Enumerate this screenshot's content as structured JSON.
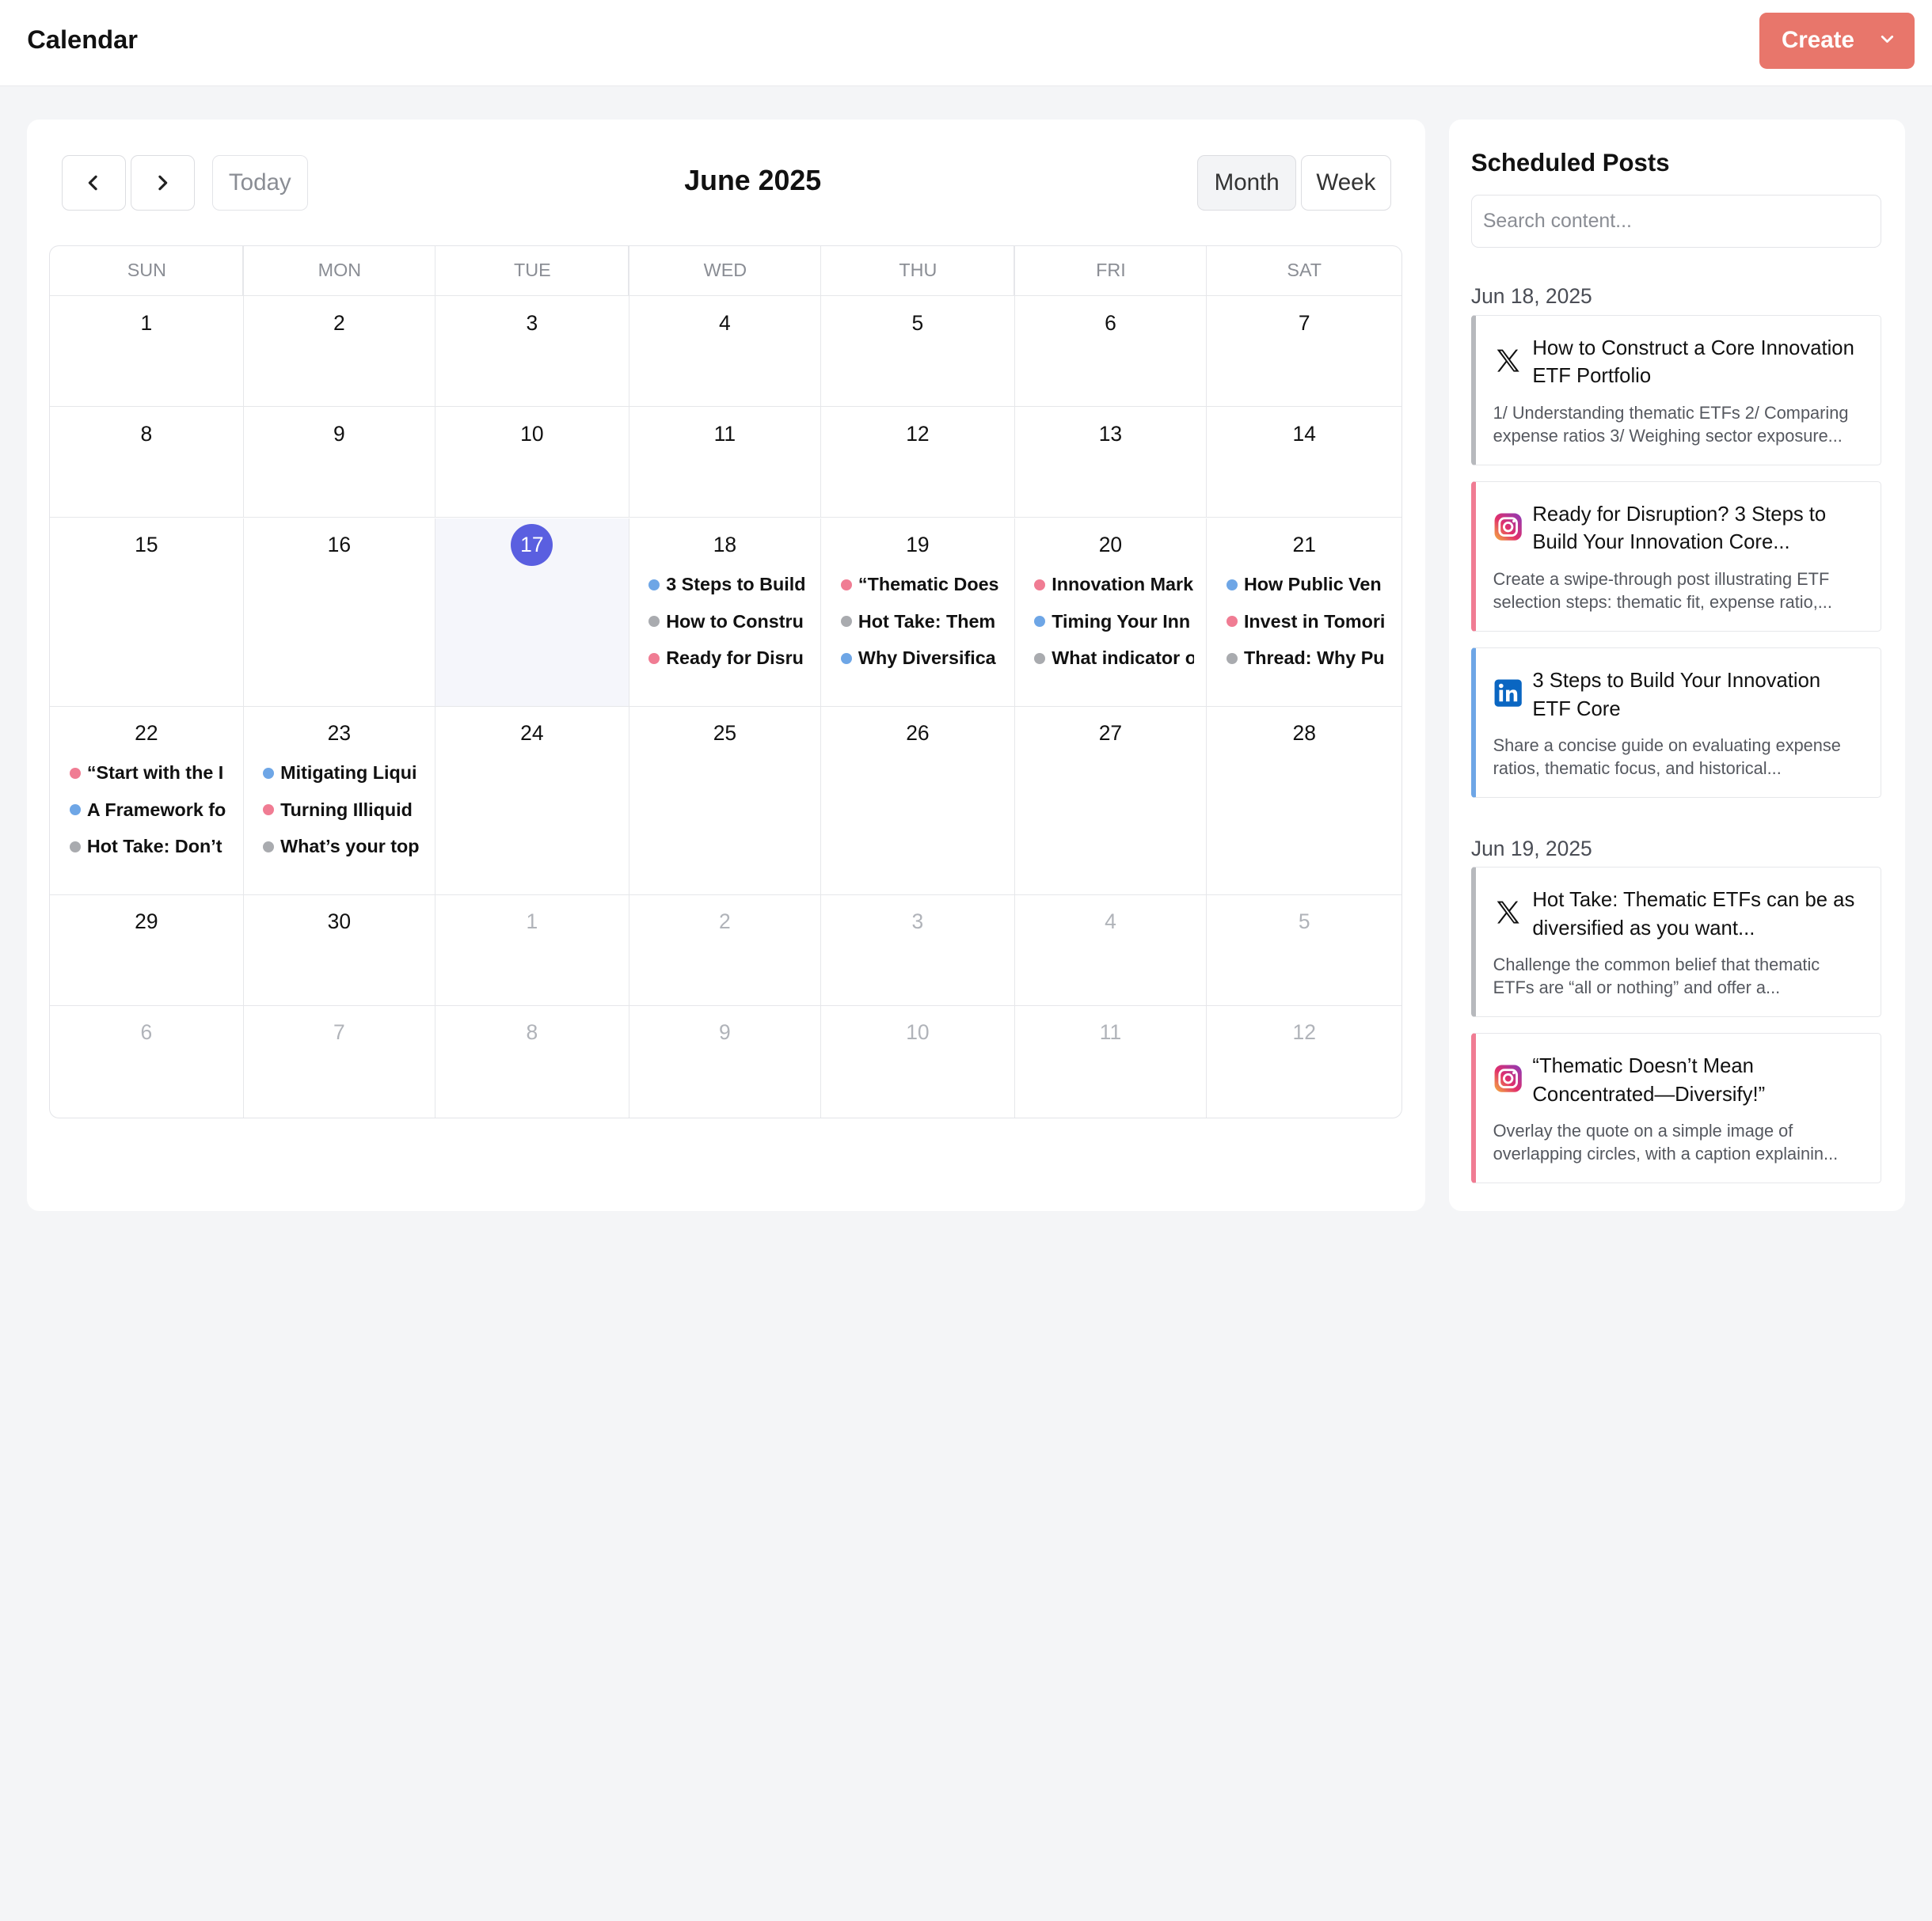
{
  "header": {
    "title": "Calendar",
    "create_label": "Create"
  },
  "calendar": {
    "today_label": "Today",
    "month_title": "June 2025",
    "views": [
      "Month",
      "Week"
    ],
    "active_view": "Month",
    "weekdays": [
      "SUN",
      "MON",
      "TUE",
      "WED",
      "THU",
      "FRI",
      "SAT"
    ],
    "today": 17,
    "weeks": [
      [
        {
          "d": "1"
        },
        {
          "d": "2"
        },
        {
          "d": "3"
        },
        {
          "d": "4"
        },
        {
          "d": "5"
        },
        {
          "d": "6"
        },
        {
          "d": "7"
        }
      ],
      [
        {
          "d": "8"
        },
        {
          "d": "9"
        },
        {
          "d": "10"
        },
        {
          "d": "11"
        },
        {
          "d": "12"
        },
        {
          "d": "13"
        },
        {
          "d": "14"
        }
      ],
      [
        {
          "d": "15"
        },
        {
          "d": "16"
        },
        {
          "d": "17",
          "today": true
        },
        {
          "d": "18",
          "events": [
            {
              "color": "blue",
              "text": "3 Steps to Build"
            },
            {
              "color": "gray",
              "text": "How to Constru"
            },
            {
              "color": "pink",
              "text": "Ready for Disru"
            }
          ]
        },
        {
          "d": "19",
          "events": [
            {
              "color": "pink",
              "text": "“Thematic Does"
            },
            {
              "color": "gray",
              "text": "Hot Take: Them"
            },
            {
              "color": "blue",
              "text": "Why Diversifica"
            }
          ]
        },
        {
          "d": "20",
          "events": [
            {
              "color": "pink",
              "text": "Innovation Mark"
            },
            {
              "color": "blue",
              "text": "Timing Your Inn"
            },
            {
              "color": "gray",
              "text": "What indicator o"
            }
          ]
        },
        {
          "d": "21",
          "events": [
            {
              "color": "blue",
              "text": "How Public Ven"
            },
            {
              "color": "pink",
              "text": "Invest in Tomori"
            },
            {
              "color": "gray",
              "text": "Thread: Why Pu"
            }
          ]
        }
      ],
      [
        {
          "d": "22",
          "events": [
            {
              "color": "pink",
              "text": "“Start with the I"
            },
            {
              "color": "blue",
              "text": "A Framework fo"
            },
            {
              "color": "gray",
              "text": "Hot Take: Don’t"
            }
          ]
        },
        {
          "d": "23",
          "events": [
            {
              "color": "blue",
              "text": "Mitigating Liqui"
            },
            {
              "color": "pink",
              "text": "Turning Illiquid"
            },
            {
              "color": "gray",
              "text": "What’s your top"
            }
          ]
        },
        {
          "d": "24"
        },
        {
          "d": "25"
        },
        {
          "d": "26"
        },
        {
          "d": "27"
        },
        {
          "d": "28"
        }
      ],
      [
        {
          "d": "29"
        },
        {
          "d": "30"
        },
        {
          "d": "1",
          "muted": true
        },
        {
          "d": "2",
          "muted": true
        },
        {
          "d": "3",
          "muted": true
        },
        {
          "d": "4",
          "muted": true
        },
        {
          "d": "5",
          "muted": true
        }
      ],
      [
        {
          "d": "6",
          "muted": true
        },
        {
          "d": "7",
          "muted": true
        },
        {
          "d": "8",
          "muted": true
        },
        {
          "d": "9",
          "muted": true
        },
        {
          "d": "10",
          "muted": true
        },
        {
          "d": "11",
          "muted": true
        },
        {
          "d": "12",
          "muted": true
        }
      ]
    ]
  },
  "sidebar": {
    "title": "Scheduled Posts",
    "search_placeholder": "Search content...",
    "groups": [
      {
        "date": "Jun 18, 2025",
        "posts": [
          {
            "platform": "x",
            "bar": "gray",
            "title": "How to Construct a Core Innovation ETF Portfolio",
            "body": "1/ Understanding thematic ETFs 2/ Comparing expense ratios 3/ Weighing sector exposure..."
          },
          {
            "platform": "instagram",
            "bar": "pink",
            "title": "Ready for Disruption? 3 Steps to Build Your Innovation Core...",
            "body": "Create a swipe-through post illustrating ETF selection steps: thematic fit, expense ratio,..."
          },
          {
            "platform": "linkedin",
            "bar": "blue",
            "title": "3 Steps to Build Your Innovation ETF Core",
            "body": "Share a concise guide on evaluating expense ratios, thematic focus, and historical..."
          }
        ]
      },
      {
        "date": "Jun 19, 2025",
        "posts": [
          {
            "platform": "x",
            "bar": "gray",
            "title": "Hot Take: Thematic ETFs can be as diversified as you want...",
            "body": "Challenge the common belief that thematic ETFs are “all or nothing” and offer a..."
          },
          {
            "platform": "instagram",
            "bar": "pink",
            "title": "“Thematic Doesn’t Mean Concentrated—Diversify!”",
            "body": "Overlay the quote on a simple image of overlapping circles, with a caption explainin..."
          }
        ]
      }
    ]
  },
  "colors": {
    "accent": "#e8766b",
    "today": "#5a5fe0",
    "blue": "#6ea6e6",
    "pink": "#f07c93",
    "gray": "#a9abaf"
  }
}
